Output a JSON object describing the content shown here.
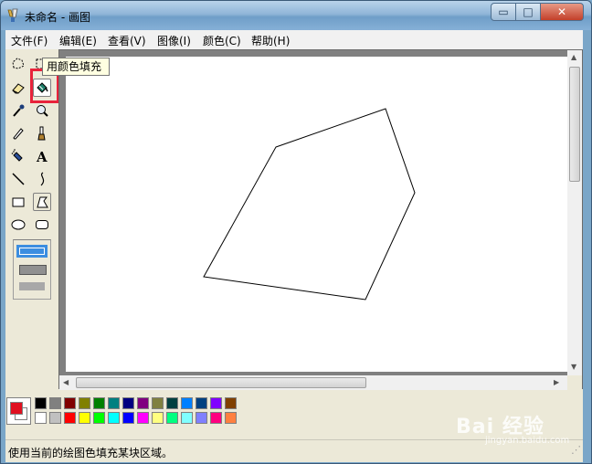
{
  "window": {
    "title": "未命名 - 画图"
  },
  "caption_buttons": {
    "minimize": "▭",
    "maximize": "□",
    "close": "✕"
  },
  "menu": [
    "文件(F)",
    "编辑(E)",
    "查看(V)",
    "图像(I)",
    "颜色(C)",
    "帮助(H)"
  ],
  "tools": [
    "free-select",
    "rect-select",
    "eraser",
    "fill-with-color",
    "pick-color",
    "magnifier",
    "pencil",
    "brush",
    "airbrush",
    "text",
    "line",
    "curve",
    "rectangle",
    "polygon",
    "ellipse",
    "rounded-rectangle"
  ],
  "tooltip": {
    "text": "用颜色填充"
  },
  "highlight": {
    "color": "#e8233b"
  },
  "palette": {
    "foreground": "#e01020",
    "background": "#ffffff",
    "row1": [
      "#000000",
      "#808080",
      "#800000",
      "#808000",
      "#008000",
      "#008080",
      "#000080",
      "#800080",
      "#808040",
      "#004040",
      "#0080ff",
      "#004080",
      "#8000ff",
      "#804000"
    ],
    "row2": [
      "#ffffff",
      "#c0c0c0",
      "#ff0000",
      "#ffff00",
      "#00ff00",
      "#00ffff",
      "#0000ff",
      "#ff00ff",
      "#ffff80",
      "#00ff80",
      "#80ffff",
      "#8080ff",
      "#ff0080",
      "#ff8040"
    ]
  },
  "status": {
    "text": "使用当前的绘图色填充某块区域。"
  },
  "watermark": {
    "brand": "Bai 经验",
    "sub": "jingyan.baidu.com"
  }
}
